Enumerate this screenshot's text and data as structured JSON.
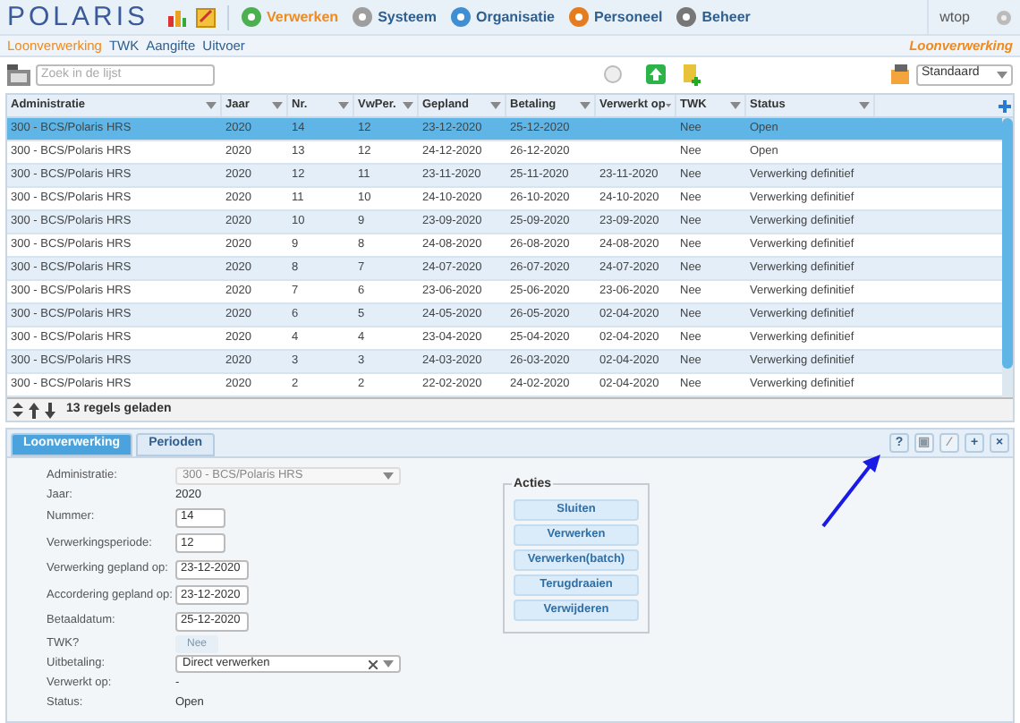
{
  "header": {
    "logo": "POLARIS",
    "nav": [
      {
        "label": "Verwerken",
        "selected": true
      },
      {
        "label": "Systeem",
        "selected": false
      },
      {
        "label": "Organisatie",
        "selected": false
      },
      {
        "label": "Personeel",
        "selected": false
      },
      {
        "label": "Beheer",
        "selected": false
      }
    ],
    "user": "wtop"
  },
  "subnav": {
    "items": [
      {
        "label": "Loonverwerking",
        "selected": true
      },
      {
        "label": "TWK",
        "selected": false
      },
      {
        "label": "Aangifte",
        "selected": false
      },
      {
        "label": "Uitvoer",
        "selected": false
      }
    ],
    "page_title": "Loonverwerking"
  },
  "toolbar": {
    "search_placeholder": "Zoek in de lijst",
    "view": "Standaard"
  },
  "table": {
    "columns": [
      "Administratie",
      "Jaar",
      "Nr.",
      "VwPer.",
      "Gepland",
      "Betaling",
      "Verwerkt op",
      "TWK",
      "Status"
    ],
    "rows": [
      {
        "cells": [
          "300 - BCS/Polaris HRS",
          "2020",
          "14",
          "12",
          "23-12-2020",
          "25-12-2020",
          "",
          "Nee",
          "Open"
        ],
        "selected": true
      },
      {
        "cells": [
          "300 - BCS/Polaris HRS",
          "2020",
          "13",
          "12",
          "24-12-2020",
          "26-12-2020",
          "",
          "Nee",
          "Open"
        ],
        "selected": false
      },
      {
        "cells": [
          "300 - BCS/Polaris HRS",
          "2020",
          "12",
          "11",
          "23-11-2020",
          "25-11-2020",
          "23-11-2020",
          "Nee",
          "Verwerking definitief"
        ],
        "selected": false
      },
      {
        "cells": [
          "300 - BCS/Polaris HRS",
          "2020",
          "11",
          "10",
          "24-10-2020",
          "26-10-2020",
          "24-10-2020",
          "Nee",
          "Verwerking definitief"
        ],
        "selected": false
      },
      {
        "cells": [
          "300 - BCS/Polaris HRS",
          "2020",
          "10",
          "9",
          "23-09-2020",
          "25-09-2020",
          "23-09-2020",
          "Nee",
          "Verwerking definitief"
        ],
        "selected": false
      },
      {
        "cells": [
          "300 - BCS/Polaris HRS",
          "2020",
          "9",
          "8",
          "24-08-2020",
          "26-08-2020",
          "24-08-2020",
          "Nee",
          "Verwerking definitief"
        ],
        "selected": false
      },
      {
        "cells": [
          "300 - BCS/Polaris HRS",
          "2020",
          "8",
          "7",
          "24-07-2020",
          "26-07-2020",
          "24-07-2020",
          "Nee",
          "Verwerking definitief"
        ],
        "selected": false
      },
      {
        "cells": [
          "300 - BCS/Polaris HRS",
          "2020",
          "7",
          "6",
          "23-06-2020",
          "25-06-2020",
          "23-06-2020",
          "Nee",
          "Verwerking definitief"
        ],
        "selected": false
      },
      {
        "cells": [
          "300 - BCS/Polaris HRS",
          "2020",
          "6",
          "5",
          "24-05-2020",
          "26-05-2020",
          "02-04-2020",
          "Nee",
          "Verwerking definitief"
        ],
        "selected": false
      },
      {
        "cells": [
          "300 - BCS/Polaris HRS",
          "2020",
          "4",
          "4",
          "23-04-2020",
          "25-04-2020",
          "02-04-2020",
          "Nee",
          "Verwerking definitief"
        ],
        "selected": false
      },
      {
        "cells": [
          "300 - BCS/Polaris HRS",
          "2020",
          "3",
          "3",
          "24-03-2020",
          "26-03-2020",
          "02-04-2020",
          "Nee",
          "Verwerking definitief"
        ],
        "selected": false
      },
      {
        "cells": [
          "300 - BCS/Polaris HRS",
          "2020",
          "2",
          "2",
          "22-02-2020",
          "24-02-2020",
          "02-04-2020",
          "Nee",
          "Verwerking definitief"
        ],
        "selected": false
      }
    ],
    "status": "13 regels geladen"
  },
  "detail": {
    "tabs": [
      {
        "label": "Loonverwerking",
        "selected": true
      },
      {
        "label": "Perioden",
        "selected": false
      }
    ],
    "tool_buttons": [
      {
        "label": "?",
        "disabled": false
      },
      {
        "label": "▣",
        "disabled": true
      },
      {
        "label": "⁄",
        "disabled": true
      },
      {
        "label": "+",
        "disabled": false
      },
      {
        "label": "×",
        "disabled": false
      }
    ],
    "fields": [
      {
        "kind": "select",
        "label": "Administratie:",
        "value": "300 - BCS/Polaris HRS",
        "disabled": true
      },
      {
        "kind": "text",
        "label": "Jaar:",
        "value": "2020"
      },
      {
        "kind": "input",
        "label": "Nummer:",
        "value": "14"
      },
      {
        "kind": "input",
        "label": "Verwerkingsperiode:",
        "value": "12"
      },
      {
        "kind": "date",
        "label": "Verwerking gepland op:",
        "value": "23-12-2020"
      },
      {
        "kind": "date",
        "label": "Accordering gepland op:",
        "value": "23-12-2020"
      },
      {
        "kind": "date",
        "label": "Betaaldatum:",
        "value": "25-12-2020"
      },
      {
        "kind": "toggle",
        "label": "TWK?",
        "value": "Nee",
        "disabled": true
      },
      {
        "kind": "select",
        "label": "Uitbetaling:",
        "value": "Direct verwerken",
        "disabled": false
      },
      {
        "kind": "text",
        "label": "Verwerkt op:",
        "value": "-"
      },
      {
        "kind": "text",
        "label": "Status:",
        "value": "Open"
      }
    ],
    "actions_title": "Acties",
    "actions": [
      "Sluiten",
      "Verwerken",
      "Verwerken(batch)",
      "Terugdraaien",
      "Verwijderen"
    ]
  }
}
